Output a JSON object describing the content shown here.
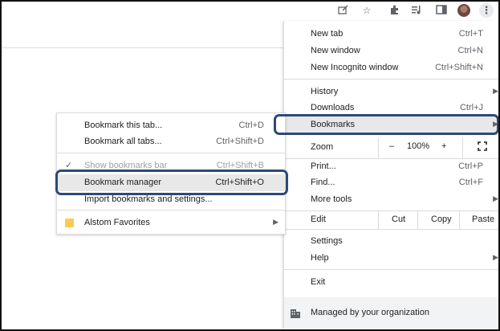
{
  "toolbar": {
    "icons": [
      "edit-icon",
      "star-icon",
      "extensions-icon",
      "media-icon",
      "sidepanel-icon",
      "avatar",
      "more-icon"
    ]
  },
  "menu": {
    "new_tab": {
      "label": "New tab",
      "shortcut": "Ctrl+T"
    },
    "new_window": {
      "label": "New window",
      "shortcut": "Ctrl+N"
    },
    "new_incognito": {
      "label": "New Incognito window",
      "shortcut": "Ctrl+Shift+N"
    },
    "history": {
      "label": "History"
    },
    "downloads": {
      "label": "Downloads",
      "shortcut": "Ctrl+J"
    },
    "bookmarks": {
      "label": "Bookmarks"
    },
    "zoom": {
      "label": "Zoom",
      "minus": "–",
      "value": "100%",
      "plus": "+"
    },
    "print": {
      "label": "Print...",
      "shortcut": "Ctrl+P"
    },
    "find": {
      "label": "Find...",
      "shortcut": "Ctrl+F"
    },
    "more_tools": {
      "label": "More tools"
    },
    "edit": {
      "label": "Edit",
      "cut": "Cut",
      "copy": "Copy",
      "paste": "Paste"
    },
    "settings": {
      "label": "Settings"
    },
    "help": {
      "label": "Help"
    },
    "exit": {
      "label": "Exit"
    },
    "managed": {
      "label": "Managed by your organization"
    }
  },
  "bookmarks_submenu": {
    "bookmark_tab": {
      "label": "Bookmark this tab...",
      "shortcut": "Ctrl+D"
    },
    "bookmark_all": {
      "label": "Bookmark all tabs...",
      "shortcut": "Ctrl+Shift+D"
    },
    "show_bar": {
      "label": "Show bookmarks bar",
      "shortcut": "Ctrl+Shift+B"
    },
    "manager": {
      "label": "Bookmark manager",
      "shortcut": "Ctrl+Shift+O"
    },
    "import": {
      "label": "Import bookmarks and settings..."
    },
    "folder": {
      "label": "Alstom Favorites"
    }
  },
  "colors": {
    "highlight_outline": "#2c4a7a",
    "hover_bg": "#e8e8e8",
    "folder": "#f9cb53"
  }
}
